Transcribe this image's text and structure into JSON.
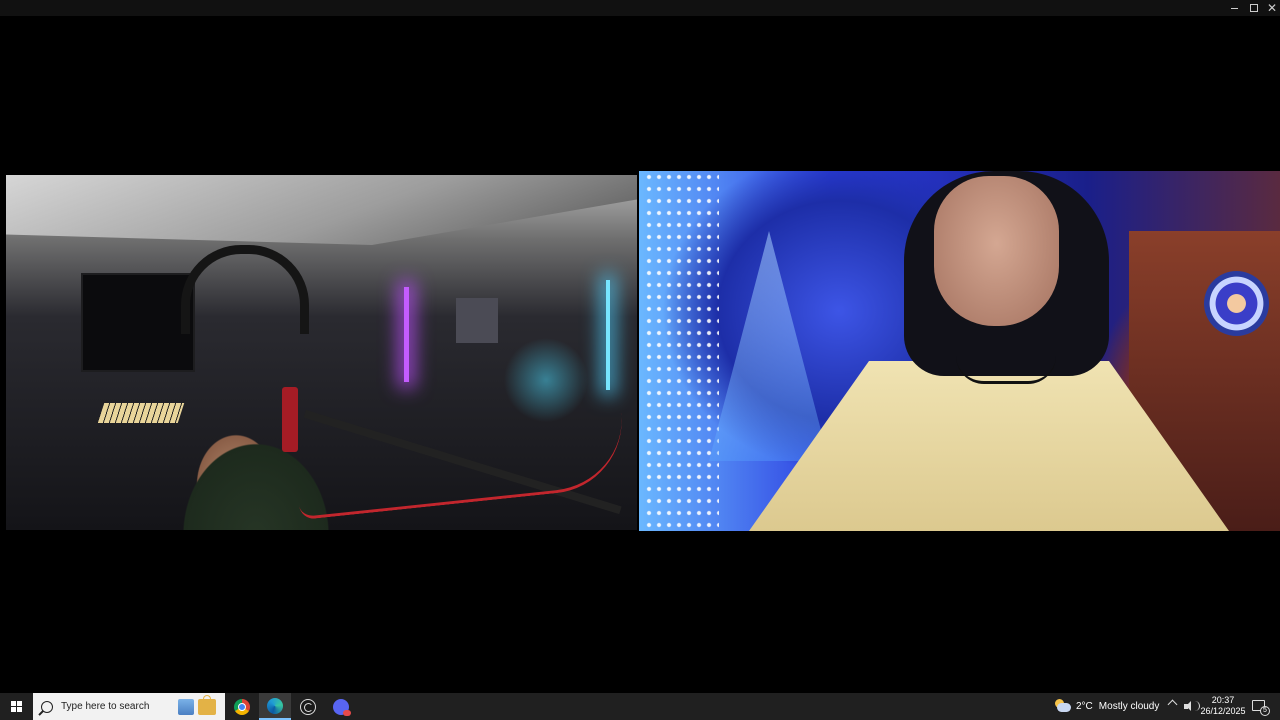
{
  "taskbar": {
    "search_placeholder": "Type here to search",
    "apps": [
      "news-icon",
      "store-icon",
      "chrome-icon",
      "edge-icon",
      "obs-icon",
      "discord-icon"
    ],
    "active_app": "edge-icon",
    "accent_color": "#7cc3ff"
  },
  "tray": {
    "weather": {
      "temperature": "2°C",
      "condition": "Mostly cloudy",
      "icon": "partly-cloudy-icon"
    },
    "clock": {
      "time": "20:37",
      "date": "26/12/2025"
    },
    "notifications_count": "5"
  },
  "feeds": {
    "left": {
      "description_icon": "webcam-feed"
    },
    "right": {
      "description_icon": "webcam-feed"
    }
  }
}
